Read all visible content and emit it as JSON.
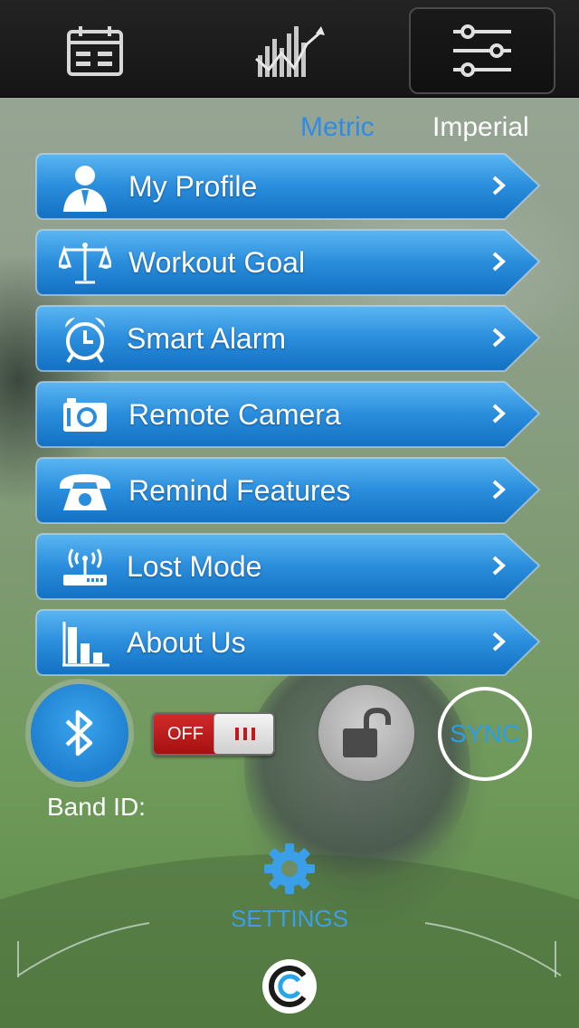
{
  "topbar": {
    "tabs": [
      {
        "name": "calendar-icon",
        "active": false
      },
      {
        "name": "statistics-chart-icon",
        "active": false
      },
      {
        "name": "settings-sliders-icon",
        "active": true
      }
    ]
  },
  "units": {
    "metric": "Metric",
    "imperial": "Imperial",
    "selected": "Metric"
  },
  "menu": {
    "items": [
      {
        "label": "My Profile",
        "icon": "user-profile-icon"
      },
      {
        "label": "Workout Goal",
        "icon": "balance-scale-icon"
      },
      {
        "label": "Smart Alarm",
        "icon": "alarm-clock-icon"
      },
      {
        "label": "Remote Camera",
        "icon": "camera-icon"
      },
      {
        "label": "Remind Features",
        "icon": "telephone-icon"
      },
      {
        "label": "Lost Mode",
        "icon": "wifi-router-icon"
      },
      {
        "label": "About Us",
        "icon": "bar-chart-icon"
      }
    ]
  },
  "controls": {
    "bluetooth_icon": "bluetooth-icon",
    "toggle_label": "OFF",
    "toggle_state": "off",
    "lock_icon": "unlocked-padlock-icon",
    "sync_label": "SYNC",
    "band_id_label": "Band ID:"
  },
  "bottom_nav": {
    "settings_label": "SETTINGS",
    "settings_icon": "gear-icon",
    "logo_icon": "brand-logo-icon"
  },
  "colors": {
    "accent_blue": "#2e8ce6",
    "menu_blue": "#1f86d6",
    "toggle_red": "#c21a1a"
  }
}
